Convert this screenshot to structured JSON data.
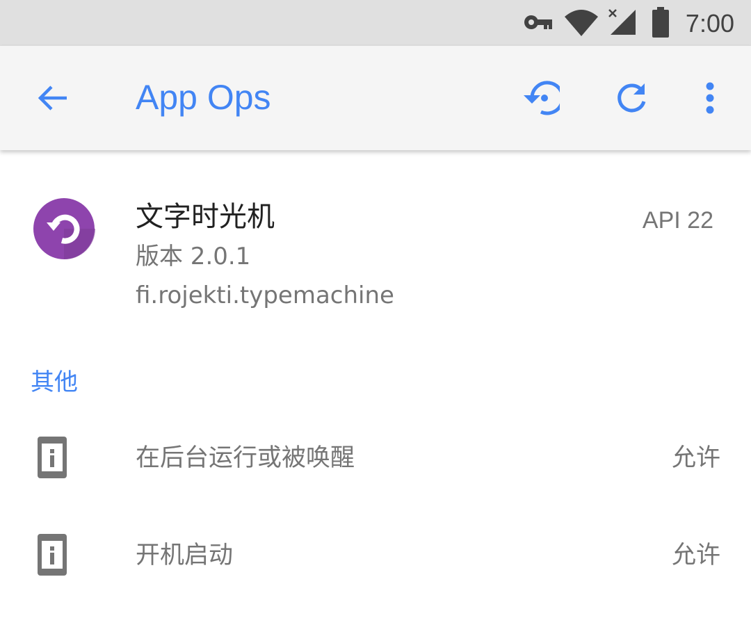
{
  "status_bar": {
    "time": "7:00",
    "icons": [
      "vpn-key-icon",
      "wifi-icon",
      "cell-signal-no-data-icon",
      "battery-icon"
    ]
  },
  "app_bar": {
    "title": "App Ops",
    "accent_color": "#4285f4",
    "actions": [
      "back-arrow-icon",
      "restore-history-icon",
      "refresh-icon",
      "more-vert-icon"
    ]
  },
  "app_info": {
    "name": "文字时光机",
    "version": "版本 2.0.1",
    "package": "fi.rojekti.typemachine",
    "api": "API 22",
    "logo_color": "#8e44ad"
  },
  "section": {
    "title": "其他"
  },
  "permissions": [
    {
      "label": "在后台运行或被唤醒",
      "value": "允许",
      "icon": "info-device-icon"
    },
    {
      "label": "开机启动",
      "value": "允许",
      "icon": "info-device-icon"
    }
  ]
}
